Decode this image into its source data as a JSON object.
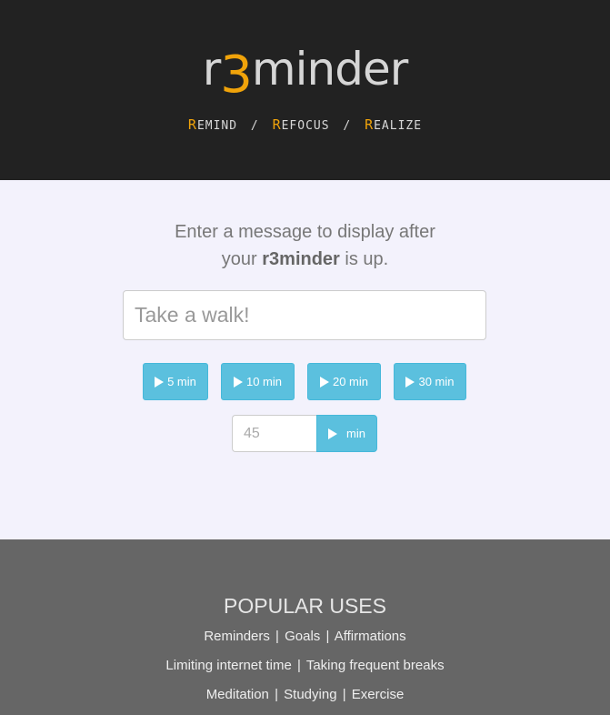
{
  "header": {
    "logo": {
      "prefix": "r",
      "three": "3",
      "suffix": "minder"
    },
    "tagline": [
      {
        "cap": "R",
        "rest": "EMIND"
      },
      {
        "cap": "R",
        "rest": "EFOCUS"
      },
      {
        "cap": "R",
        "rest": "EALIZE"
      }
    ],
    "separator": "/"
  },
  "main": {
    "prompt_line1": "Enter a message to display after",
    "prompt_line2_pre": "your ",
    "prompt_line2_bold": "r3minder",
    "prompt_line2_post": " is up.",
    "message_placeholder": "Take a walk!",
    "quick_buttons": [
      "5 min",
      "10 min",
      "20 min",
      "30 min"
    ],
    "custom_placeholder": "45",
    "custom_button_label": "min"
  },
  "footer": {
    "title": "POPULAR USES",
    "lines": [
      [
        "Reminders",
        "Goals",
        "Affirmations"
      ],
      [
        "Limiting internet time",
        "Taking frequent breaks"
      ],
      [
        "Meditation",
        "Studying",
        "Exercise"
      ]
    ]
  },
  "colors": {
    "header_bg": "#222222",
    "accent_orange": "#f0a30a",
    "main_bg": "#f3f2fc",
    "button_info": "#5bc0de",
    "footer_bg": "#666666"
  }
}
